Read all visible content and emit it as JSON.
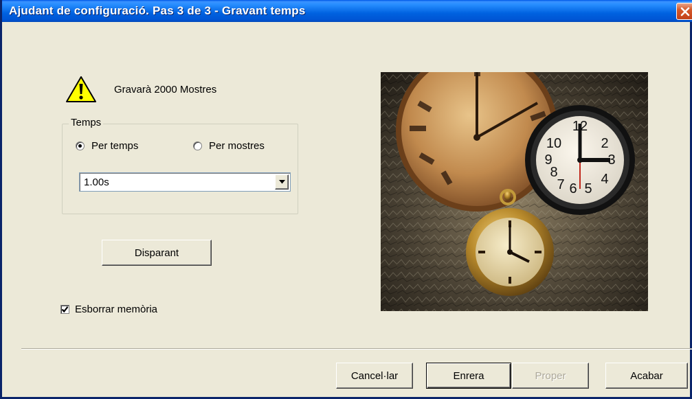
{
  "window": {
    "title": "Ajudant de configuració. Pas 3 de 3 - Gravant temps",
    "close_icon": "close-icon"
  },
  "info": {
    "icon": "warning-icon",
    "text": "Gravarà 2000 Mostres"
  },
  "time_group": {
    "legend": "Temps",
    "radio_by_time": {
      "label": "Per temps",
      "checked": true
    },
    "radio_by_samples": {
      "label": "Per mostres",
      "checked": false
    },
    "duration_select": {
      "value": "1.00s"
    }
  },
  "trigger_button": {
    "label": "Disparant"
  },
  "clear_memory": {
    "label": "Esborrar memòria",
    "checked": true
  },
  "footer": {
    "cancel_label": "Cancel·lar",
    "back_label": "Enrera",
    "next_label": "Proper",
    "next_enabled": false,
    "finish_label": "Acabar"
  },
  "colors": {
    "titlebar": "#0058e6",
    "dialog_bg": "#ece9d8",
    "close_button": "#d5582a",
    "disabled_text": "#aca899"
  }
}
